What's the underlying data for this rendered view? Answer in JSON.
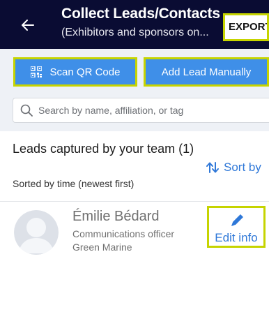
{
  "header": {
    "title": "Collect Leads/Contacts",
    "subtitle": "(Exhibitors and sponsors on...",
    "export_label": "EXPORT"
  },
  "actions": {
    "scan_label": "Scan QR Code",
    "add_label": "Add Lead Manually"
  },
  "search": {
    "placeholder": "Search by name, affiliation, or tag"
  },
  "leads_section": {
    "title": "Leads captured by your team (1)",
    "sort_label": "Sort by",
    "sorted_note": "Sorted by time (newest first)"
  },
  "leads": [
    {
      "name": "Émilie Bédard",
      "role": "Communications officer",
      "organization": "Green Marine",
      "edit_label": "Edit info"
    }
  ],
  "colors": {
    "header_bg": "#0a0c33",
    "accent": "#3f8fe8",
    "link": "#2f78d8",
    "highlight_border": "#c6d400"
  }
}
